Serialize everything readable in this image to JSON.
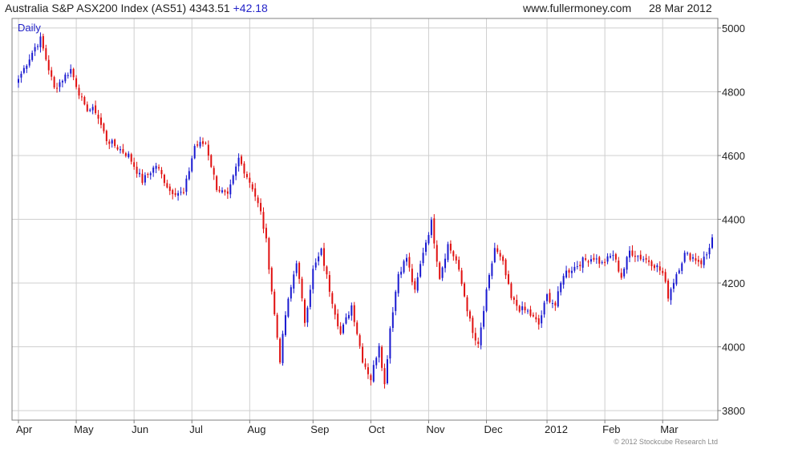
{
  "header": {
    "index_name": "Australia S&P ASX200 Index (AS51)",
    "last": "4343.51",
    "change": "+42.18",
    "site": "www.fullermoney.com",
    "date": "28 Mar 2012"
  },
  "period_label": "Daily",
  "copyright": "© 2012 Stockcube Research Ltd",
  "colors": {
    "up": "#1a1ad0",
    "down": "#e01010",
    "grid": "#cfcfcf",
    "frame": "#808080",
    "accent": "#2323c8"
  },
  "chart_data": {
    "type": "candlestick",
    "title": "Australia S&P ASX200 Index (AS51)",
    "ylim": [
      3770,
      5030
    ],
    "y_ticks": [
      3800,
      4000,
      4200,
      4400,
      4600,
      4800,
      5000
    ],
    "x_ticks": [
      {
        "label": "Apr",
        "idx": 0
      },
      {
        "label": "May",
        "idx": 21
      },
      {
        "label": "Jun",
        "idx": 42
      },
      {
        "label": "Jul",
        "idx": 63
      },
      {
        "label": "Aug",
        "idx": 84
      },
      {
        "label": "Sep",
        "idx": 107
      },
      {
        "label": "Oct",
        "idx": 128
      },
      {
        "label": "Nov",
        "idx": 149
      },
      {
        "label": "Dec",
        "idx": 170
      },
      {
        "label": "2012",
        "idx": 192
      },
      {
        "label": "Feb",
        "idx": 213
      },
      {
        "label": "Mar",
        "idx": 234
      }
    ],
    "grid": true,
    "legend": "none",
    "anchors": [
      [
        0,
        4840
      ],
      [
        6,
        4940
      ],
      [
        8,
        4965
      ],
      [
        13,
        4810
      ],
      [
        19,
        4870
      ],
      [
        24,
        4750
      ],
      [
        28,
        4740
      ],
      [
        32,
        4650
      ],
      [
        40,
        4600
      ],
      [
        45,
        4520
      ],
      [
        50,
        4570
      ],
      [
        55,
        4490
      ],
      [
        60,
        4480
      ],
      [
        64,
        4630
      ],
      [
        68,
        4640
      ],
      [
        72,
        4500
      ],
      [
        76,
        4470
      ],
      [
        80,
        4590
      ],
      [
        85,
        4500
      ],
      [
        88,
        4420
      ],
      [
        90,
        4330
      ],
      [
        93,
        4100
      ],
      [
        95,
        3960
      ],
      [
        97,
        4100
      ],
      [
        101,
        4270
      ],
      [
        104,
        4080
      ],
      [
        107,
        4240
      ],
      [
        110,
        4300
      ],
      [
        113,
        4180
      ],
      [
        117,
        4040
      ],
      [
        121,
        4130
      ],
      [
        125,
        3960
      ],
      [
        128,
        3900
      ],
      [
        131,
        4010
      ],
      [
        133,
        3880
      ],
      [
        135,
        4060
      ],
      [
        138,
        4230
      ],
      [
        141,
        4280
      ],
      [
        144,
        4170
      ],
      [
        147,
        4300
      ],
      [
        150,
        4390
      ],
      [
        153,
        4220
      ],
      [
        156,
        4320
      ],
      [
        159,
        4270
      ],
      [
        162,
        4160
      ],
      [
        165,
        4040
      ],
      [
        167,
        4000
      ],
      [
        170,
        4170
      ],
      [
        173,
        4310
      ],
      [
        176,
        4260
      ],
      [
        179,
        4150
      ],
      [
        182,
        4120
      ],
      [
        185,
        4110
      ],
      [
        189,
        4070
      ],
      [
        192,
        4160
      ],
      [
        195,
        4130
      ],
      [
        198,
        4230
      ],
      [
        202,
        4250
      ],
      [
        205,
        4270
      ],
      [
        209,
        4280
      ],
      [
        212,
        4260
      ],
      [
        216,
        4290
      ],
      [
        219,
        4220
      ],
      [
        222,
        4300
      ],
      [
        226,
        4280
      ],
      [
        229,
        4270
      ],
      [
        232,
        4250
      ],
      [
        234,
        4230
      ],
      [
        236,
        4160
      ],
      [
        239,
        4230
      ],
      [
        242,
        4290
      ],
      [
        245,
        4280
      ],
      [
        248,
        4265
      ],
      [
        250,
        4290
      ],
      [
        252,
        4343
      ]
    ]
  }
}
